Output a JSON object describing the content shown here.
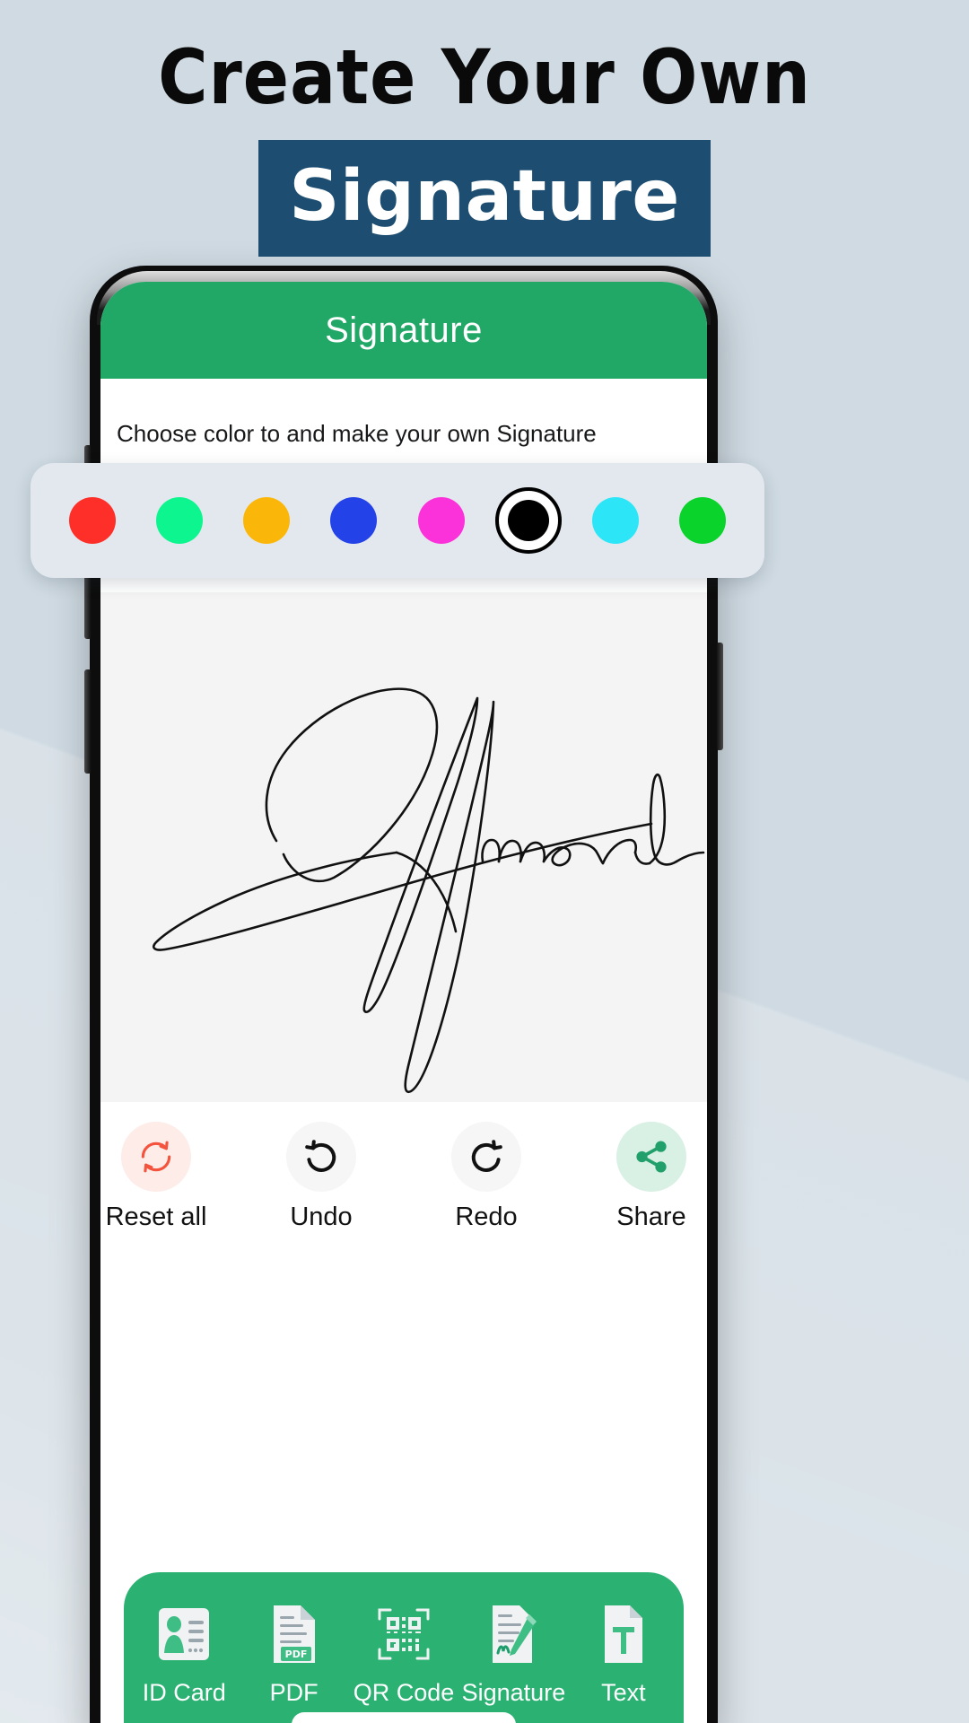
{
  "promo": {
    "line1": "Create Your Own",
    "badge": "Signature",
    "badge_bg": "#1d4e72",
    "page_bg": "#cfdae2"
  },
  "app": {
    "appbar": {
      "title": "Signature",
      "bg": "#21a866"
    },
    "instruction": "Choose color to and make your own Signature",
    "colors": {
      "selected_index": 5,
      "swatches": [
        {
          "name": "red",
          "hex": "#fd2f28",
          "selected": false
        },
        {
          "name": "spring-green",
          "hex": "#0cf58f",
          "selected": false
        },
        {
          "name": "amber",
          "hex": "#fbb709",
          "selected": false
        },
        {
          "name": "blue",
          "hex": "#2342e8",
          "selected": false
        },
        {
          "name": "magenta",
          "hex": "#fb31d9",
          "selected": false
        },
        {
          "name": "black",
          "hex": "#000000",
          "selected": true
        },
        {
          "name": "cyan",
          "hex": "#2ce6f7",
          "selected": false
        },
        {
          "name": "green",
          "hex": "#0ad32b",
          "selected": false
        }
      ]
    },
    "canvas": {
      "signature_text": "Amanda",
      "stroke_color": "#111111",
      "bg": "#f4f4f4"
    },
    "actions": [
      {
        "label": "Reset all",
        "icon": "reset-icon",
        "accent": "#f4533d",
        "circle_bg": "#fdece8"
      },
      {
        "label": "Undo",
        "icon": "undo-icon",
        "accent": "#111111",
        "circle_bg": "#f6f6f6"
      },
      {
        "label": "Redo",
        "icon": "redo-icon",
        "accent": "#111111",
        "circle_bg": "#f6f6f6"
      },
      {
        "label": "Share",
        "icon": "share-icon",
        "accent": "#22a06b",
        "circle_bg": "#d9f0e4"
      }
    ],
    "bottom_nav": {
      "bg": "#2bb273",
      "active_index": 3,
      "items": [
        {
          "label": "ID Card",
          "icon": "id-card-icon"
        },
        {
          "label": "PDF",
          "icon": "pdf-file-icon"
        },
        {
          "label": "QR Code",
          "icon": "qr-code-icon"
        },
        {
          "label": "Signature",
          "icon": "signature-document-icon"
        },
        {
          "label": "Text",
          "icon": "text-file-icon"
        }
      ]
    }
  }
}
